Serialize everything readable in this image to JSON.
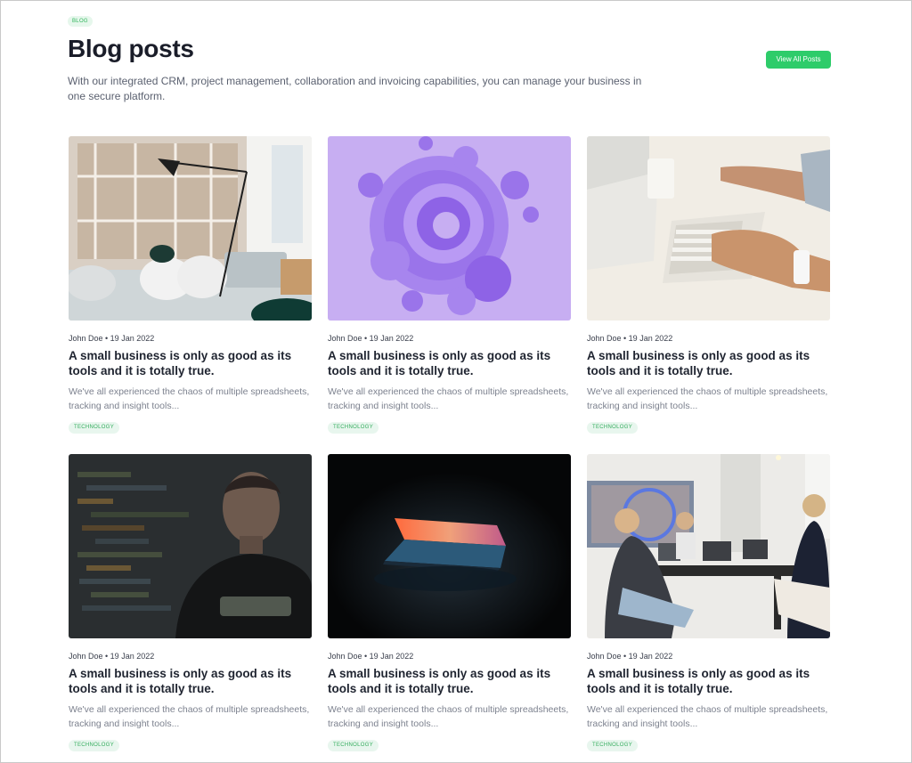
{
  "badge": "BLOG",
  "page_title": "Blog posts",
  "subtitle": "With our integrated CRM, project management, collaboration and invoicing capabilities, you can manage your business in one secure platform.",
  "view_all_label": "View All Posts",
  "posts": [
    {
      "meta": "John Doe • 19 Jan 2022",
      "title": "A small business is only as good as its tools and it is totally true.",
      "excerpt": "We've all experienced the chaos of multiple spreadsheets, tracking and insight tools...",
      "tag": "TECHNOLOGY",
      "image": "office-interior-photo"
    },
    {
      "meta": "John Doe • 19 Jan 2022",
      "title": "A small business is only as good as its tools and it is totally true.",
      "excerpt": "We've all experienced the chaos of multiple spreadsheets, tracking and insight tools...",
      "tag": "TECHNOLOGY",
      "image": "purple-3d-abstract-photo"
    },
    {
      "meta": "John Doe • 19 Jan 2022",
      "title": "A small business is only as good as its tools and it is totally true.",
      "excerpt": "We've all experienced the chaos of multiple spreadsheets, tracking and insight tools...",
      "tag": "TECHNOLOGY",
      "image": "keyboard-desk-photo"
    },
    {
      "meta": "John Doe • 19 Jan 2022",
      "title": "A small business is only as good as its tools and it is totally true.",
      "excerpt": "We've all experienced the chaos of multiple spreadsheets, tracking and insight tools...",
      "tag": "TECHNOLOGY",
      "image": "developer-code-photo"
    },
    {
      "meta": "John Doe • 19 Jan 2022",
      "title": "A small business is only as good as its tools and it is totally true.",
      "excerpt": "We've all experienced the chaos of multiple spreadsheets, tracking and insight tools...",
      "tag": "TECHNOLOGY",
      "image": "glowing-laptop-photo"
    },
    {
      "meta": "John Doe • 19 Jan 2022",
      "title": "A small business is only as good as its tools and it is totally true.",
      "excerpt": "We've all experienced the chaos of multiple spreadsheets, tracking and insight tools...",
      "tag": "TECHNOLOGY",
      "image": "team-meeting-photo"
    }
  ],
  "colors": {
    "accent": "#2ecc6a",
    "tag_bg": "#e8f6ee",
    "tag_text": "#35ad5e",
    "heading": "#1a1d29",
    "body_text": "#7d828f"
  }
}
